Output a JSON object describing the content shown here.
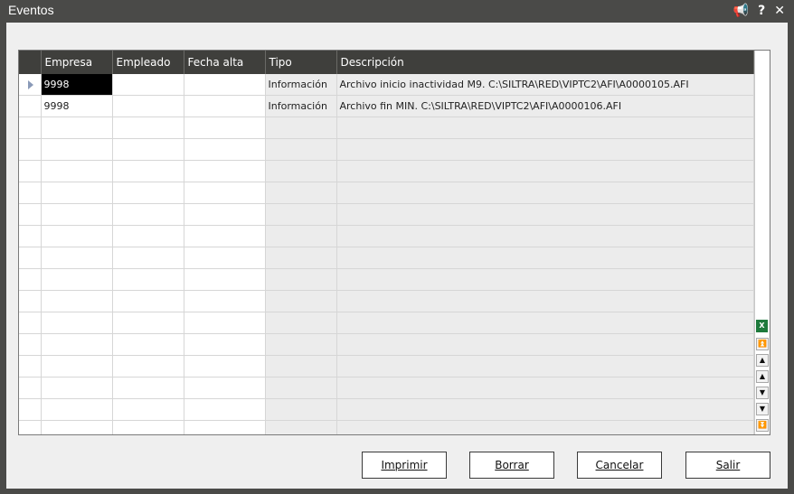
{
  "window": {
    "title": "Eventos"
  },
  "grid": {
    "columns": [
      "Empresa",
      "Empleado",
      "Fecha alta",
      "Tipo",
      "Descripción"
    ],
    "rows": [
      {
        "empresa": "9998",
        "empleado": "",
        "fecha_alta": "",
        "tipo": "Información",
        "descripcion": "Archivo inicio inactividad M9. C:\\SILTRA\\RED\\VIPTC2\\AFI\\A0000105.AFI"
      },
      {
        "empresa": "9998",
        "empleado": "",
        "fecha_alta": "",
        "tipo": "Información",
        "descripcion": "Archivo fin MIN. C:\\SILTRA\\RED\\VIPTC2\\AFI\\A0000106.AFI"
      }
    ],
    "excel_icon_label": "X"
  },
  "buttons": {
    "imprimir": "Imprimir",
    "borrar": "Borrar",
    "cancelar": "Cancelar",
    "salir": "Salir"
  }
}
